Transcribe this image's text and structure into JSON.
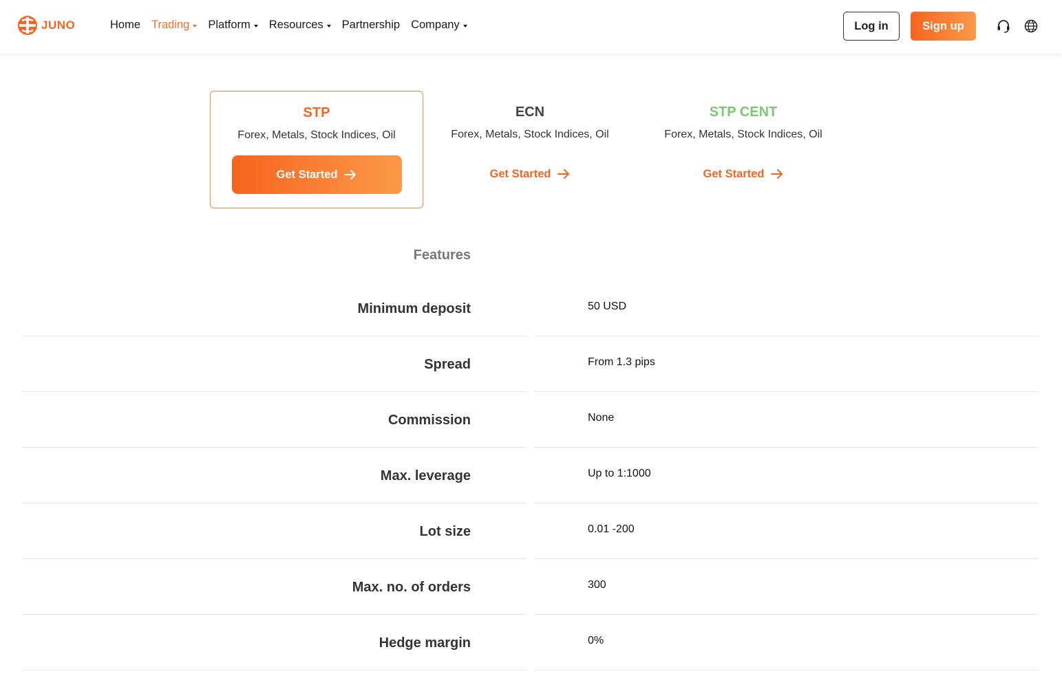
{
  "brand": {
    "name": "JUNO",
    "accent": "#f26522",
    "cent_color": "#7cc96b"
  },
  "nav": {
    "items": [
      {
        "label": "Home",
        "dropdown": false,
        "active": false
      },
      {
        "label": "Trading",
        "dropdown": true,
        "active": true
      },
      {
        "label": "Platform",
        "dropdown": true,
        "active": false
      },
      {
        "label": "Resources",
        "dropdown": true,
        "active": false
      },
      {
        "label": "Partnership",
        "dropdown": false,
        "active": false
      },
      {
        "label": "Company",
        "dropdown": true,
        "active": false
      }
    ]
  },
  "header": {
    "login_label": "Log in",
    "signup_label": "Sign up",
    "icons": [
      "headset-icon",
      "globe-icon"
    ]
  },
  "accounts": [
    {
      "title": "STP",
      "subtitle": "Forex, Metals, Stock Indices, Oil",
      "cta": "Get Started",
      "selected": true,
      "title_color": "#f26522"
    },
    {
      "title": "ECN",
      "subtitle": "Forex, Metals, Stock Indices, Oil",
      "cta": "Get Started",
      "selected": false,
      "title_color": "#444444"
    },
    {
      "title": "STP CENT",
      "subtitle": "Forex, Metals, Stock Indices, Oil",
      "cta": "Get Started",
      "selected": false,
      "title_color": "#7cc96b"
    }
  ],
  "features": {
    "heading": "Features",
    "rows": [
      {
        "label": "Minimum deposit",
        "value": "50 USD"
      },
      {
        "label": "Spread",
        "value": "From 1.3 pips"
      },
      {
        "label": "Commission",
        "value": "None"
      },
      {
        "label": "Max. leverage",
        "value": "Up to 1:1000"
      },
      {
        "label": "Lot size",
        "value": "0.01 -200"
      },
      {
        "label": "Max. no. of orders",
        "value": "300"
      },
      {
        "label": "Hedge margin",
        "value": "0%"
      }
    ]
  }
}
